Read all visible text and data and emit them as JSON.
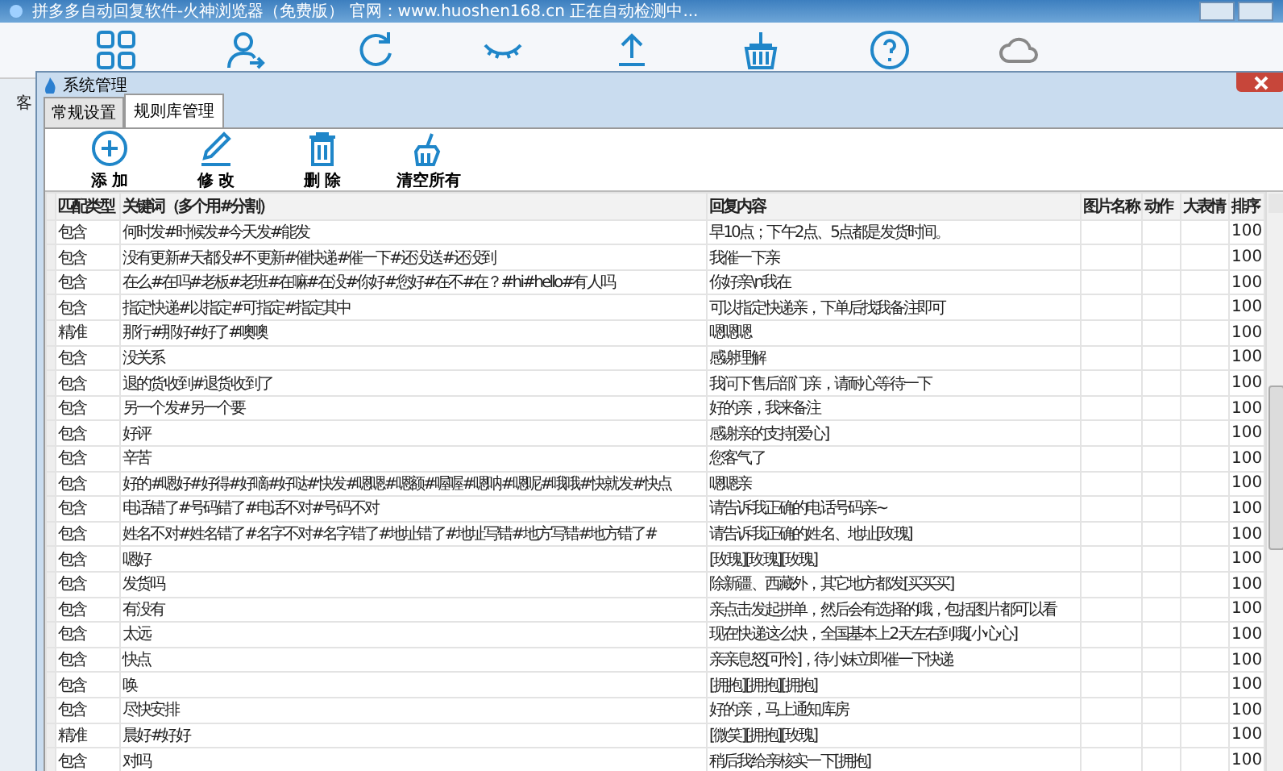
{
  "app": {
    "title": "拼多多自动回复软件-火神浏览器（免费版） 官网：www.huoshen168.cn 正在自动检测中..."
  },
  "background_label": "客",
  "dialog": {
    "title": "系统管理",
    "tabs": [
      {
        "label": "常规设置",
        "selected": false
      },
      {
        "label": "规则库管理",
        "selected": true
      }
    ],
    "actions": [
      {
        "label": "添 加",
        "kind": "add"
      },
      {
        "label": "修 改",
        "kind": "edit"
      },
      {
        "label": "删 除",
        "kind": "delete"
      },
      {
        "label": "清空所有",
        "kind": "clear"
      }
    ],
    "table": {
      "columns": [
        "匹配类型",
        "关键词（多个用#分割）",
        "回复内容",
        "图片名称",
        "动作",
        "大表情",
        "排序"
      ],
      "rows": [
        {
          "type": "包含",
          "keyword": "何时发#时候发#今天发#能发",
          "reply": "早10点；下午2点、5点都是发货时间。",
          "sort": "100"
        },
        {
          "type": "包含",
          "keyword": "没有更新#天都没#不更新#催快递#催一下#还没送#还没到",
          "reply": "我催一下亲",
          "sort": "100"
        },
        {
          "type": "包含",
          "keyword": "在么#在吗#老板#老班#在嘛#在没#你好#您好#在不#在？#hi#hello#有人吗",
          "reply": "你好亲\\n我在",
          "sort": "100"
        },
        {
          "type": "包含",
          "keyword": "指定快递#以指定#可指定#指定其中",
          "reply": "可以指定快递亲，下单后找我备注即可",
          "sort": "100"
        },
        {
          "type": "精准",
          "keyword": "那行#那好#好了#噢噢",
          "reply": "嗯嗯嗯",
          "sort": "100"
        },
        {
          "type": "包含",
          "keyword": "没关系",
          "reply": "感谢理解",
          "sort": "100"
        },
        {
          "type": "包含",
          "keyword": "退的货收到#退货收到了",
          "reply": "我问下售后部门亲，请耐心等待一下",
          "sort": "100"
        },
        {
          "type": "包含",
          "keyword": "另一个发#另一个要",
          "reply": "好的亲，我来备注",
          "sort": "100"
        },
        {
          "type": "包含",
          "keyword": "好评",
          "reply": "感谢亲的支持[爱心]",
          "sort": "100"
        },
        {
          "type": "包含",
          "keyword": "辛苦",
          "reply": "您客气了",
          "sort": "100"
        },
        {
          "type": "包含",
          "keyword": "好的#嗯好#好得#好嘀#好哒#快发#嗯嗯#嗯额#喔喔#嗯呐#嗯呢#哦哦#快就发#快点",
          "reply": "嗯嗯亲",
          "sort": "100"
        },
        {
          "type": "包含",
          "keyword": "电话错了#号码错了#电话不对#号码不对",
          "reply": "请告诉我正确的电话号码亲~",
          "sort": "100"
        },
        {
          "type": "包含",
          "keyword": "姓名不对#姓名错了#名字不对#名字错了#地址错了#地址写错#地方写错#地方错了#",
          "reply": "请告诉我正确的姓名、地址[玫瑰]",
          "sort": "100"
        },
        {
          "type": "包含",
          "keyword": "嗯好",
          "reply": "[玫瑰][玫瑰][玫瑰]",
          "sort": "100"
        },
        {
          "type": "包含",
          "keyword": "发货吗",
          "reply": "除新疆、西藏外，其它地方都发[买买买]",
          "sort": "100"
        },
        {
          "type": "包含",
          "keyword": "有没有",
          "reply": "亲点击发起拼单，然后会有选择的哦，包括图片都可以看",
          "sort": "100"
        },
        {
          "type": "包含",
          "keyword": "太远",
          "reply": "现在快递这么快，全国基本上2天左右到哦[小心心]",
          "sort": "100"
        },
        {
          "type": "包含",
          "keyword": "快点",
          "reply": "亲亲息怒[可怜]，待小妹立即催一下快递",
          "sort": "100"
        },
        {
          "type": "包含",
          "keyword": "唤",
          "reply": "[拥抱][拥抱][拥抱]",
          "sort": "100"
        },
        {
          "type": "包含",
          "keyword": "尽快安排",
          "reply": "好的亲，马上通知库房",
          "sort": "100"
        },
        {
          "type": "精准",
          "keyword": "晨好#好好",
          "reply": "[微笑][拥抱][玫瑰]",
          "sort": "100"
        },
        {
          "type": "包含",
          "keyword": "对吗",
          "reply": "稍后我给亲核实一下[拥抱]",
          "sort": "100"
        }
      ]
    }
  }
}
